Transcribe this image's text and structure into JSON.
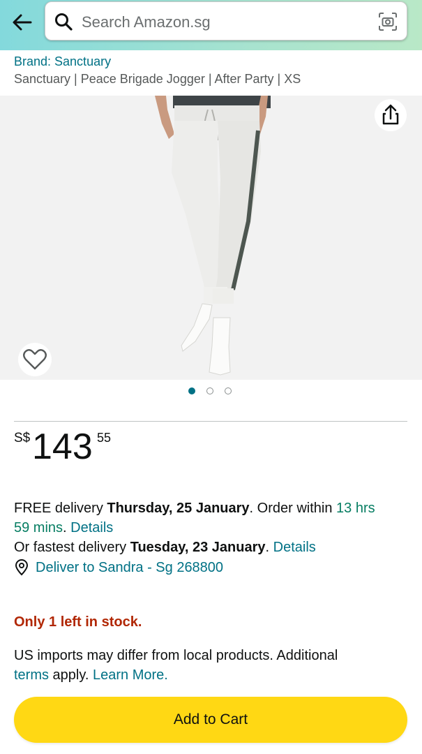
{
  "header": {
    "search_placeholder": "Search Amazon.sg",
    "back_icon": "back-arrow-icon",
    "search_icon": "search-icon",
    "camera_icon": "camera-search-icon",
    "gradient_colors": [
      "#83d9dc",
      "#b9e8c7"
    ]
  },
  "product": {
    "brand": "Brand: Sanctuary",
    "title": "Sanctuary | Peace Brigade Jogger | After Party | XS"
  },
  "gallery": {
    "image_count": 3,
    "active_index": 0,
    "share_icon": "share-icon",
    "wishlist_icon": "heart-icon"
  },
  "price": {
    "currency": "S$",
    "whole": "143",
    "fraction": "55"
  },
  "delivery": {
    "free_prefix": "FREE delivery ",
    "free_date": "Thursday, 25 January",
    "order_within": ". Order within ",
    "countdown_part1": "13 hrs",
    "countdown_part2": "59 mins",
    "period": ". ",
    "details_label": "Details",
    "fastest_prefix": "Or fastest delivery ",
    "fastest_date": "Tuesday, 23 January",
    "fastest_period": ". ",
    "fastest_details_label": "Details",
    "deliver_to": "Deliver to Sandra - Sg 268800",
    "location_icon": "location-pin-icon"
  },
  "stock": {
    "message": "Only 1 left in stock."
  },
  "imports": {
    "line1": "US imports may differ from local products. Additional",
    "terms_label": "terms",
    "apply_text": " apply. ",
    "learn_more_label": "Learn More."
  },
  "cart": {
    "add_label": "Add to Cart",
    "button_color": "#ffd814"
  },
  "colors": {
    "link": "#007185",
    "green": "#067d62",
    "stock_red": "#b12704"
  }
}
